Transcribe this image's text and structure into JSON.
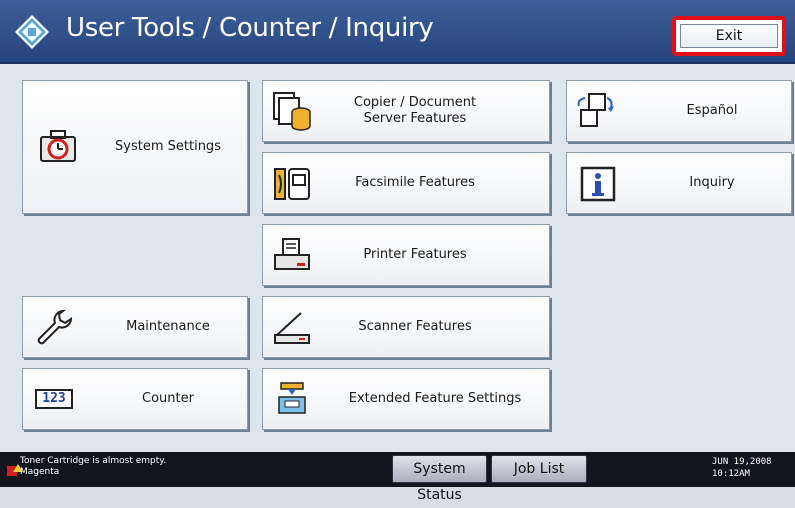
{
  "header": {
    "title": "User Tools / Counter / Inquiry",
    "exit_label": "Exit"
  },
  "tiles": {
    "system_settings": "System Settings",
    "copier": "Copier / Document Server Features",
    "espanol": "Español",
    "facsimile": "Facsimile Features",
    "inquiry": "Inquiry",
    "printer": "Printer Features",
    "maintenance": "Maintenance",
    "scanner": "Scanner Features",
    "counter": "Counter",
    "counter_icon_text": "123",
    "extended": "Extended Feature Settings"
  },
  "footer": {
    "alert_line1": "Toner Cartridge is almost empty.",
    "alert_line2": "Magenta",
    "system_status": "System Status",
    "job_list": "Job List",
    "date": "JUN  19,2008",
    "time": "10:12AM"
  },
  "colors": {
    "header_bg": "#2f4f8b",
    "exit_outline": "#e0101a",
    "footer_bg": "#11151d"
  },
  "icons": {
    "header": "diamond-arrows-icon",
    "system_settings": "toolbox-clock-icon",
    "copier": "copier-document-server-icon",
    "espanol": "language-switch-icon",
    "facsimile": "fax-icon",
    "inquiry": "info-icon",
    "printer": "printer-icon",
    "maintenance": "wrench-icon",
    "scanner": "scanner-icon",
    "counter": "counter-123-icon",
    "extended": "extended-feature-icon",
    "alert": "toner-alert-icon"
  }
}
